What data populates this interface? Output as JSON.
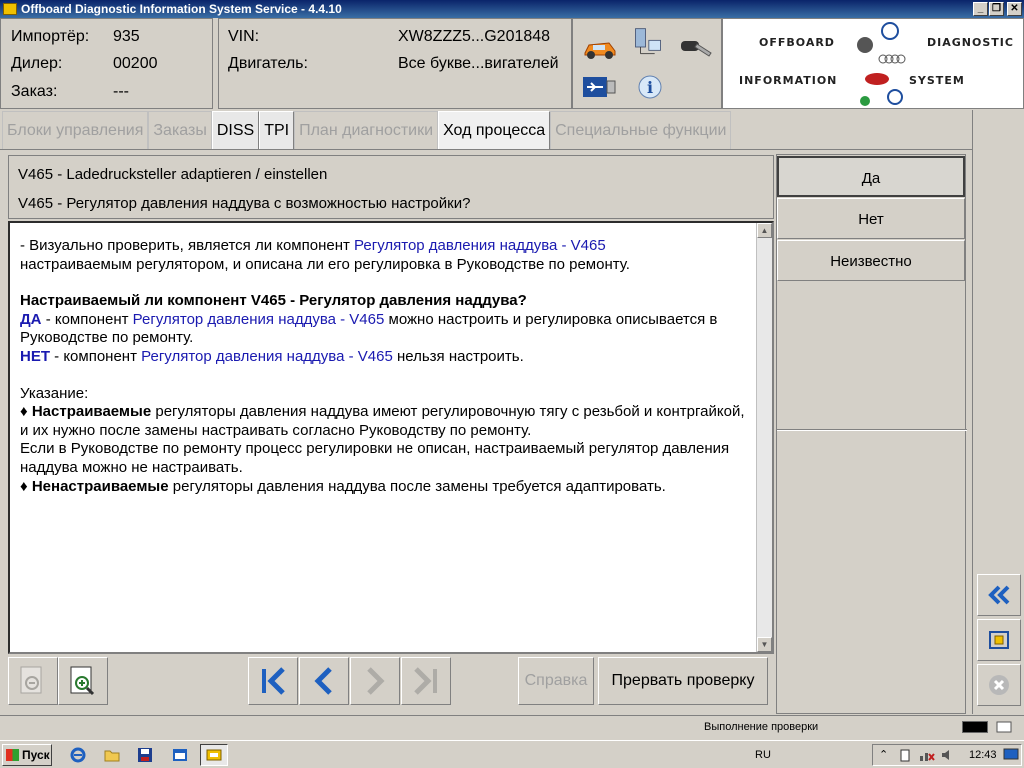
{
  "window": {
    "title": "Offboard Diagnostic Information System Service - 4.4.10"
  },
  "info": {
    "importer_label": "Импортёр:",
    "importer_value": "935",
    "dealer_label": "Дилер:",
    "dealer_value": "00200",
    "order_label": "Заказ:",
    "order_value": "---",
    "vin_label": "VIN:",
    "vin_value": "XW8ZZZ5...G201848",
    "engine_label": "Двигатель:",
    "engine_value": "Все букве...вигателей"
  },
  "logo": {
    "offboard": "OFFBOARD",
    "diagnostic": "DIAGNOSTIC",
    "information": "INFORMATION",
    "system": "SYSTEM"
  },
  "tabs": [
    {
      "label": "Блоки управления",
      "state": "disabled"
    },
    {
      "label": "Заказы",
      "state": "disabled"
    },
    {
      "label": "DISS",
      "state": "enabled"
    },
    {
      "label": "TPI",
      "state": "enabled"
    },
    {
      "label": "План диагностики",
      "state": "disabled"
    },
    {
      "label": "Ход процесса",
      "state": "active"
    },
    {
      "label": "Специальные функции",
      "state": "disabled"
    }
  ],
  "header": {
    "line1": "V465 - Ladedrucksteller adaptieren / einstellen",
    "line2": "V465 - Регулятор давления наддува с возможностью настройки?"
  },
  "content": {
    "p1_a": "- Визуально проверить, является ли компонент ",
    "p1_link": "Регулятор давления наддува - V465",
    "p1_b": "настраиваемым регулятором, и описана ли его регулировка в Руководстве по ремонту.",
    "q": "Настраиваемый ли компонент V465 - Регулятор давления наддува?",
    "yes_key": "ДА",
    "yes_a": " - компонент ",
    "yes_link": "Регулятор давления наддува - V465",
    "yes_b": " можно настроить и регулировка описывается в Руководстве по ремонту.",
    "no_key": "НЕТ",
    "no_a": " - компонент ",
    "no_link": "Регулятор давления наддува - V465",
    "no_b": " нельзя настроить.",
    "note_label": "Указание:",
    "b1_bold": "Настраиваемые",
    "b1_text": " регуляторы давления наддува имеют регулировочную тягу с резьбой и контргайкой, и их нужно после замены настраивать согласно Руководству по ремонту.",
    "b1_text2": "Если в Руководстве по ремонту процесс регулировки не описан, настраиваемый регулятор давления наддува можно не настраивать.",
    "b2_bold": "Ненастраиваемые",
    "b2_text": " регуляторы давления наддува после замены требуется адаптировать."
  },
  "answers": {
    "yes": "Да",
    "no": "Нет",
    "unknown": "Неизвестно"
  },
  "bottom": {
    "help": "Справка",
    "abort": "Прервать проверку"
  },
  "status": {
    "text": "Выполнение проверки"
  },
  "taskbar": {
    "start": "Пуск",
    "lang": "RU",
    "time": "12:43"
  }
}
